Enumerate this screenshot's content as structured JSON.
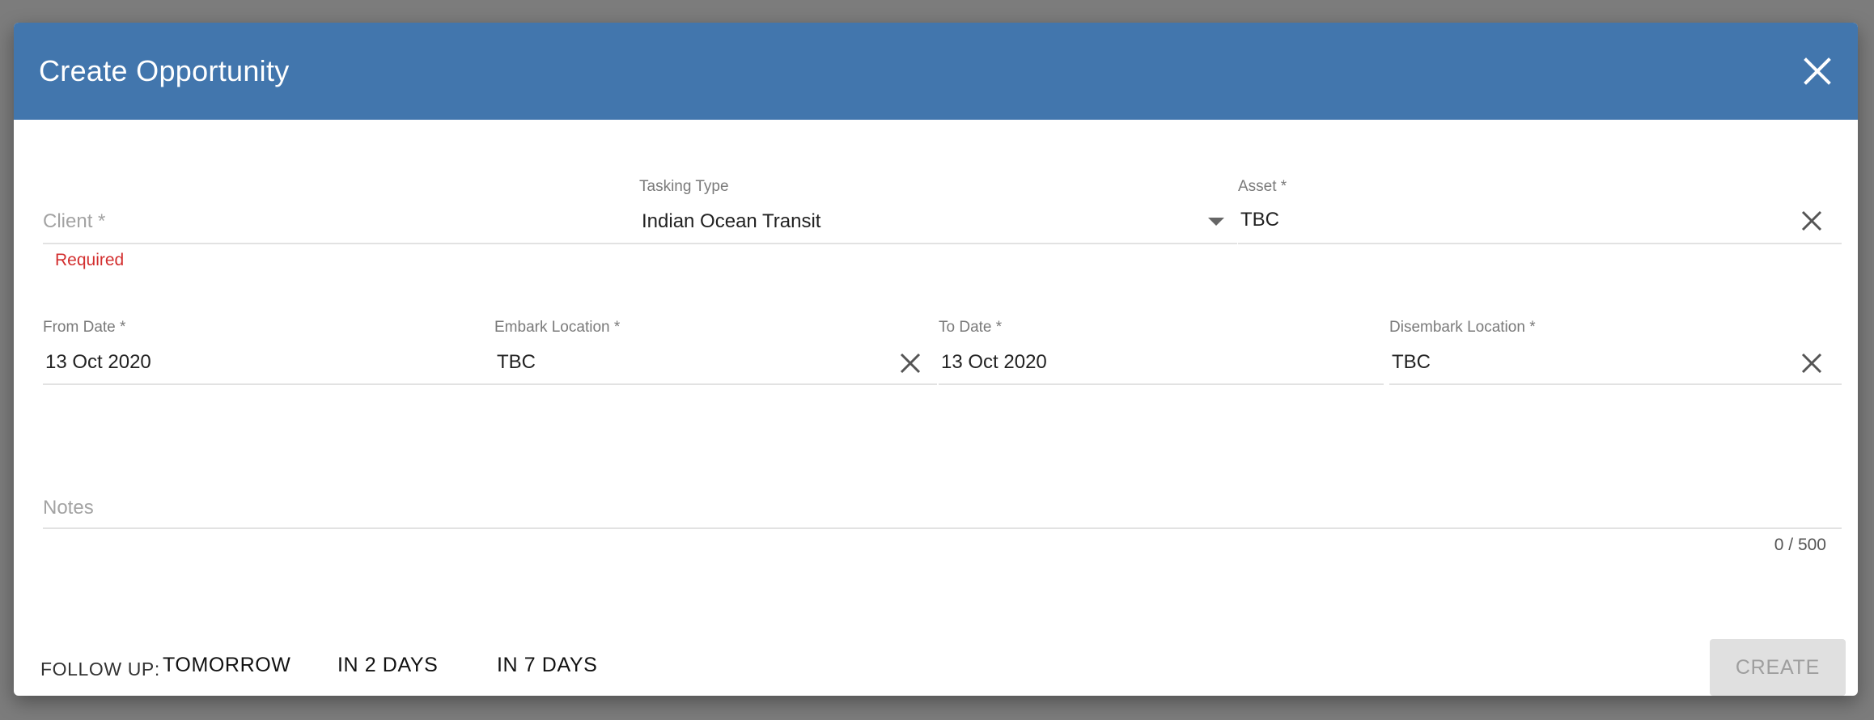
{
  "dialog": {
    "title": "Create Opportunity",
    "close_icon": "close-icon"
  },
  "form": {
    "client": {
      "placeholder": "Client *",
      "value": "",
      "error": "Required"
    },
    "tasking_type": {
      "label": "Tasking Type",
      "value": "Indian Ocean Transit",
      "icon": "chevron-down-icon"
    },
    "asset": {
      "label": "Asset *",
      "value": "TBC",
      "icon": "clear-icon"
    },
    "from_date": {
      "label": "From Date *",
      "value": "13 Oct 2020"
    },
    "embark_location": {
      "label": "Embark Location *",
      "value": "TBC",
      "icon": "clear-icon"
    },
    "to_date": {
      "label": "To Date *",
      "value": "13 Oct 2020"
    },
    "disembark_location": {
      "label": "Disembark Location *",
      "value": "TBC",
      "icon": "clear-icon"
    },
    "notes": {
      "placeholder": "Notes",
      "value": "",
      "counter": "0 / 500"
    }
  },
  "footer": {
    "follow_up_label": "FOLLOW UP:",
    "follow_up_options": [
      "TOMORROW",
      "IN 2 DAYS",
      "IN 7 DAYS"
    ],
    "create_label": "CREATE"
  },
  "colors": {
    "header": "#4276ad",
    "error": "#d32f2f",
    "disabled_button": "#e0e0e0"
  }
}
